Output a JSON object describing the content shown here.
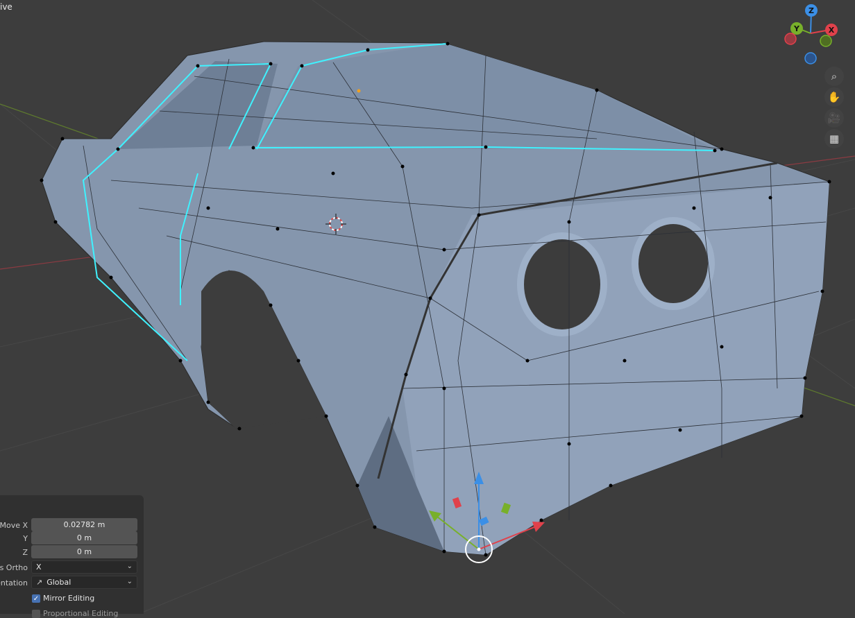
{
  "viewport": {
    "mode_label": "ive",
    "gizmo_axes": {
      "z": "Z",
      "y": "Y",
      "x": "X"
    },
    "tool_icons": [
      "zoom-icon",
      "hand-pan-icon",
      "camera-icon",
      "grid-perspective-icon"
    ],
    "colors": {
      "background": "#3d3d3d",
      "mesh": "#8d9db4",
      "selected_edge": "#3ff2ff",
      "vertex": "#000000",
      "axis_x": "#e0414b",
      "axis_y": "#78b02a",
      "axis_z": "#3b8fe6"
    }
  },
  "redo_panel": {
    "move_x_label": "Move X",
    "move_x_value": "0.02782 m",
    "y_label": "Y",
    "y_value": "0 m",
    "z_label": "Z",
    "z_value": "0 m",
    "axis_ortho_label": "Axis Ortho",
    "axis_ortho_value": "X",
    "orientation_label": "Orientation",
    "orientation_value": "Global",
    "mirror_editing_label": "Mirror Editing",
    "mirror_editing_checked": true,
    "proportional_editing_label": "Proportional Editing"
  }
}
